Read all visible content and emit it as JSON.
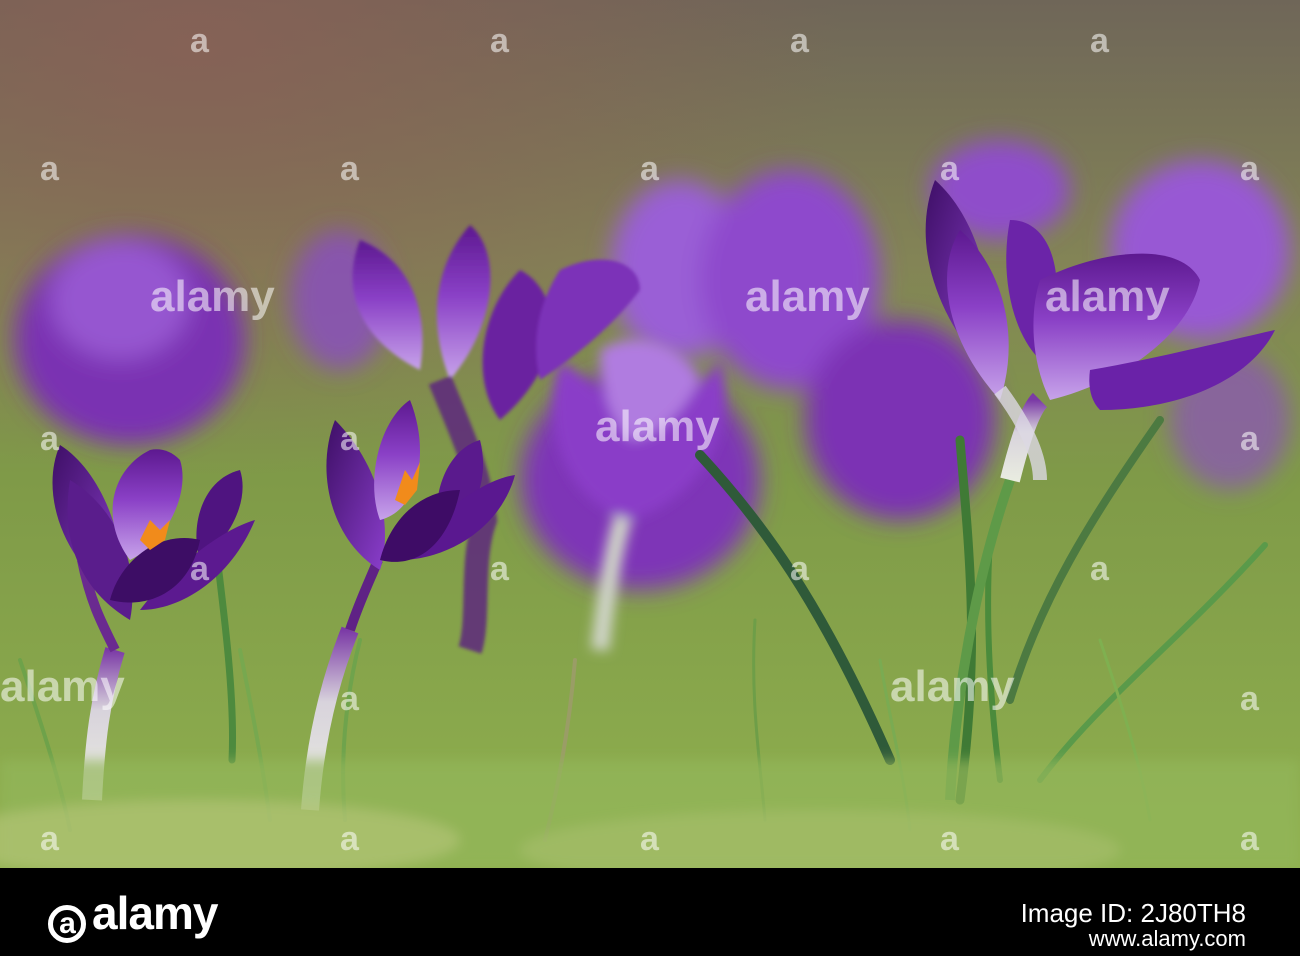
{
  "photo": {
    "subject": "purple crocus flowers in grass",
    "palette": {
      "background_top": "#6f6658",
      "background_mid": "#7f8a52",
      "grass": "#6f9a3b",
      "petal_dark": "#4a1473",
      "petal_mid": "#7a2fb0",
      "petal_light": "#b98be0",
      "stamen": "#f18b1b"
    }
  },
  "watermark": {
    "text": "alamy",
    "mark": "a"
  },
  "footer": {
    "logo_text": "alamy",
    "logo_mark": "a",
    "image_id": "Image ID: 2J80TH8",
    "url": "www.alamy.com"
  }
}
